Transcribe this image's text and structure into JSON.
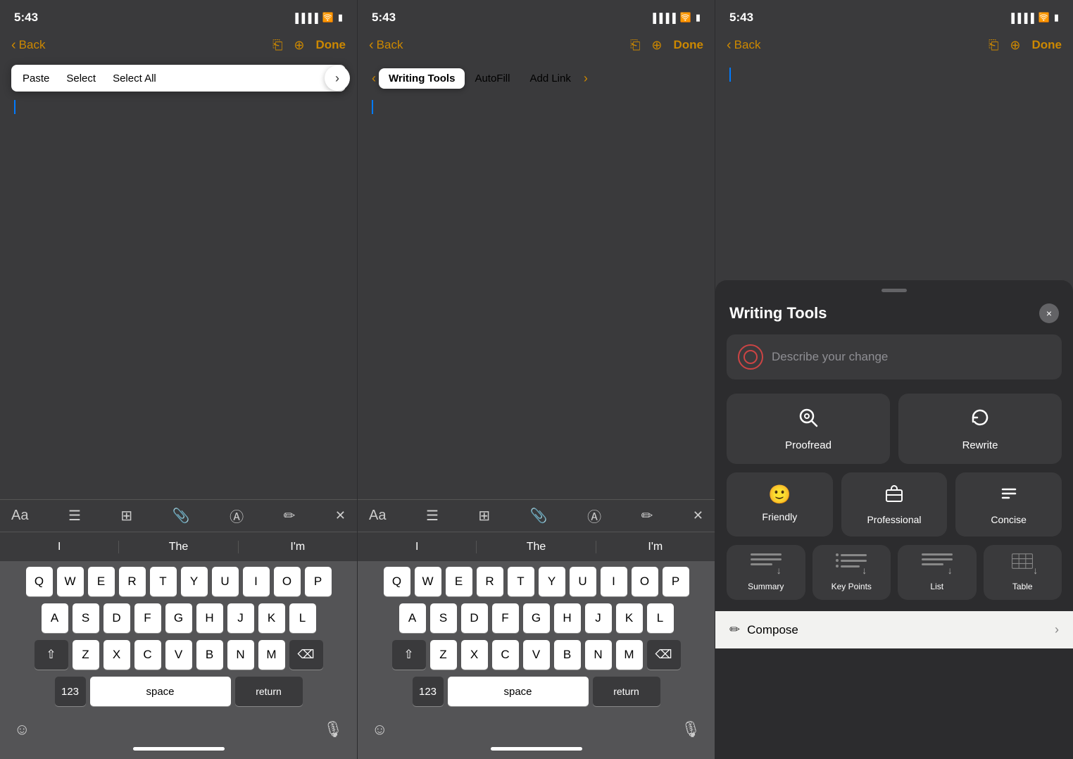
{
  "panels": [
    {
      "id": "panel1",
      "status_time": "5:43",
      "nav": {
        "back_label": "Back",
        "done_label": "Done"
      },
      "context_menu": {
        "items": [
          "Paste",
          "Select",
          "Select All"
        ],
        "more_icon": "›"
      },
      "autocomplete": {
        "words": [
          "I",
          "The",
          "I'm"
        ]
      },
      "keyboard": {
        "row1": [
          "Q",
          "W",
          "E",
          "R",
          "T",
          "Y",
          "U",
          "I",
          "O",
          "P"
        ],
        "row2": [
          "A",
          "S",
          "D",
          "F",
          "G",
          "H",
          "J",
          "K",
          "L"
        ],
        "row3": [
          "Z",
          "X",
          "C",
          "V",
          "B",
          "N",
          "M"
        ],
        "bottom": {
          "numbers": "123",
          "space": "space",
          "return": "return"
        }
      }
    },
    {
      "id": "panel2",
      "status_time": "5:43",
      "nav": {
        "back_label": "Back",
        "done_label": "Done"
      },
      "tab_bar": {
        "items": [
          "Writing Tools",
          "AutoFill",
          "Add Link"
        ]
      },
      "autocomplete": {
        "words": [
          "I",
          "The",
          "I'm"
        ]
      },
      "keyboard": {
        "row1": [
          "Q",
          "W",
          "E",
          "R",
          "T",
          "Y",
          "U",
          "I",
          "O",
          "P"
        ],
        "row2": [
          "A",
          "S",
          "D",
          "F",
          "G",
          "H",
          "J",
          "K",
          "L"
        ],
        "row3": [
          "Z",
          "X",
          "C",
          "V",
          "B",
          "N",
          "M"
        ],
        "bottom": {
          "numbers": "123",
          "space": "space",
          "return": "return"
        }
      }
    },
    {
      "id": "panel3",
      "status_time": "5:43",
      "nav": {
        "back_label": "Back",
        "done_label": "Done"
      },
      "writing_tools_sheet": {
        "title": "Writing Tools",
        "close_btn": "×",
        "describe_placeholder": "Describe your change",
        "tools": [
          {
            "icon": "🔍",
            "label": "Proofread"
          },
          {
            "icon": "↻",
            "label": "Rewrite"
          }
        ],
        "tones": [
          {
            "icon": "🙂",
            "label": "Friendly"
          },
          {
            "icon": "💼",
            "label": "Professional"
          },
          {
            "icon": "÷",
            "label": "Concise"
          }
        ],
        "formats": [
          {
            "label": "Summary"
          },
          {
            "label": "Key Points"
          },
          {
            "label": "List"
          },
          {
            "label": "Table"
          }
        ],
        "compose": {
          "label": "Compose"
        }
      }
    }
  ]
}
